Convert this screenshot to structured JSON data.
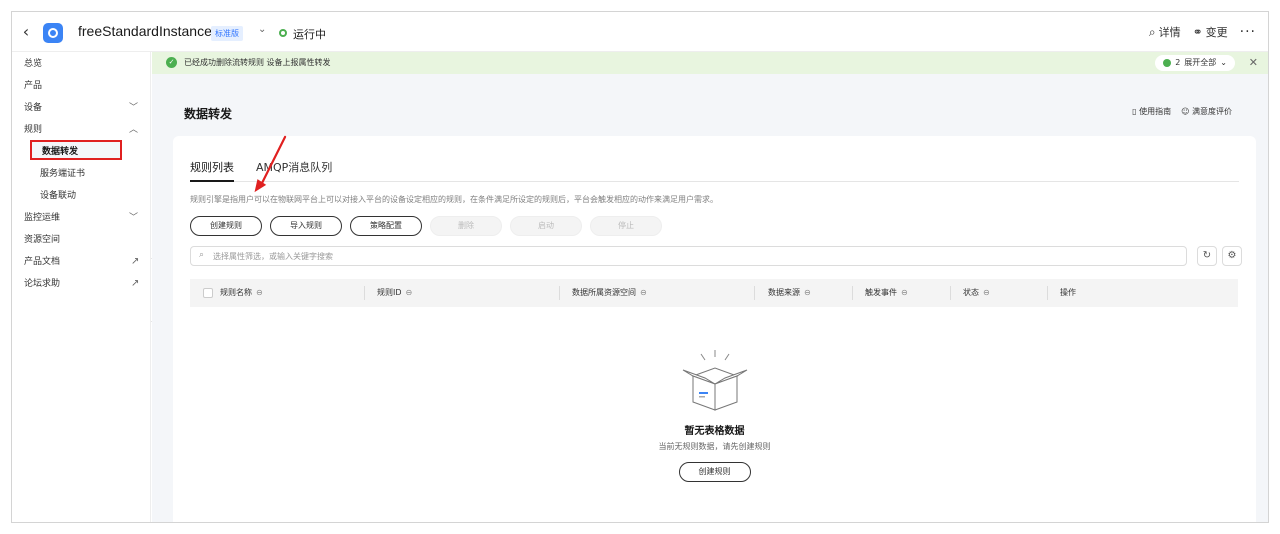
{
  "topbar": {
    "back_glyph": "‹",
    "instance_name": "freeStandardInstance",
    "edition": "标准版",
    "status": "运行中",
    "details": "详情",
    "change": "变更",
    "more": "···"
  },
  "sidebar": {
    "items": [
      {
        "label": "总览"
      },
      {
        "label": "产品"
      },
      {
        "label": "设备"
      },
      {
        "label": "规则"
      },
      {
        "label": "监控运维"
      },
      {
        "label": "资源空间"
      },
      {
        "label": "产品文档"
      },
      {
        "label": "论坛求助"
      }
    ],
    "sub_items": [
      {
        "label": "数据转发"
      },
      {
        "label": "服务端证书"
      },
      {
        "label": "设备联动"
      }
    ]
  },
  "notice": {
    "message": "已经成功删除流转规则 设备上报属性转发",
    "count": "2",
    "expand": "展开全部"
  },
  "page": {
    "title": "数据转发",
    "guide": "使用指南",
    "rating": "满意度评价"
  },
  "tabs": [
    {
      "label": "规则列表",
      "active": true
    },
    {
      "label": "AMQP消息队列",
      "active": false
    }
  ],
  "description": "规则引擎是指用户可以在物联网平台上可以对接入平台的设备设定相应的规则，在条件满足所设定的规则后，平台会触发相应的动作来满足用户需求。",
  "toolbar": {
    "create": "创建规则",
    "import": "导入规则",
    "policy": "策略配置",
    "delete": "删除",
    "start": "启动",
    "stop": "停止"
  },
  "search": {
    "placeholder": "选择属性筛选，或输入关键字搜索"
  },
  "table": {
    "columns": [
      "规则名称",
      "规则ID",
      "数据所属资源空间",
      "数据来源",
      "触发事件",
      "状态",
      "操作"
    ]
  },
  "empty": {
    "title": "暂无表格数据",
    "subtitle": "当前无规则数据，请先创建规则",
    "button": "创建规则"
  },
  "colors": {
    "accent": "#2f74ff",
    "success": "#4caf50",
    "annotation": "#e02020",
    "notice_bg": "#e8f5df"
  }
}
